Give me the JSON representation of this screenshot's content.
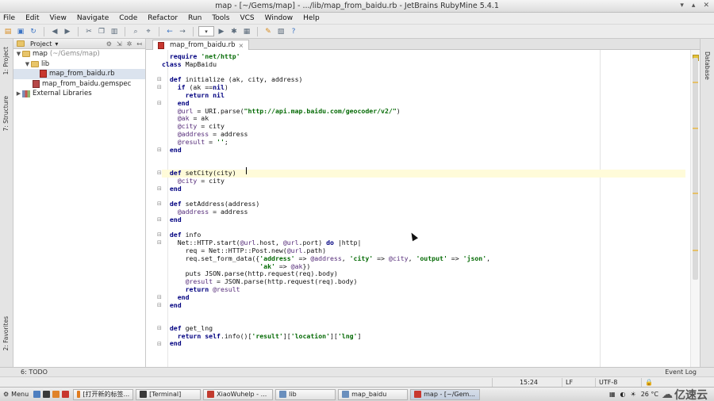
{
  "window": {
    "title": "map - [~/Gems/map] - .../lib/map_from_baidu.rb - JetBrains RubyMine 5.4.1",
    "controls": [
      "▾",
      "▴",
      "✕"
    ]
  },
  "menu": [
    "File",
    "Edit",
    "View",
    "Navigate",
    "Code",
    "Refactor",
    "Run",
    "Tools",
    "VCS",
    "Window",
    "Help"
  ],
  "left_tabs": {
    "project": "1: Project",
    "structure": "7: Structure",
    "favorites": "2: Favorites"
  },
  "right_tabs": {
    "database": "Database"
  },
  "project_panel": {
    "header": "Project",
    "tree": [
      {
        "label": "map",
        "hint": "(~/Gems/map)",
        "kind": "folder",
        "level": 0,
        "expanded": true
      },
      {
        "label": "lib",
        "hint": "",
        "kind": "folder",
        "level": 1,
        "expanded": true
      },
      {
        "label": "map_from_baidu.rb",
        "hint": "",
        "kind": "rb",
        "level": 2,
        "selected": true
      },
      {
        "label": "map_from_baidu.gemspec",
        "hint": "",
        "kind": "gem",
        "level": 1
      },
      {
        "label": "External Libraries",
        "hint": "",
        "kind": "libs",
        "level": 0,
        "collapsed": true
      }
    ]
  },
  "editor": {
    "tab": "map_from_baidu.rb"
  },
  "bottom_tools": {
    "todo": "6: TODO",
    "event_log": "Event Log"
  },
  "status": {
    "position": "15:24",
    "line_sep": "LF",
    "encoding": "UTF-8"
  },
  "taskbar": {
    "menu": "Menu",
    "items": [
      {
        "label": "[打开新的标签...",
        "color": "#e07b1f"
      },
      {
        "label": "[Terminal]",
        "color": "#3a3a3a"
      },
      {
        "label": "XiaoWuhelp - ...",
        "color": "#c23b2f"
      },
      {
        "label": "lib",
        "color": "#6a8fbd"
      },
      {
        "label": "map_baidu",
        "color": "#6a8fbd"
      },
      {
        "label": "map - [~/Gem...",
        "color": "#c8372f",
        "active": true
      }
    ],
    "weather": "26 °C",
    "brand": "亿速云"
  }
}
